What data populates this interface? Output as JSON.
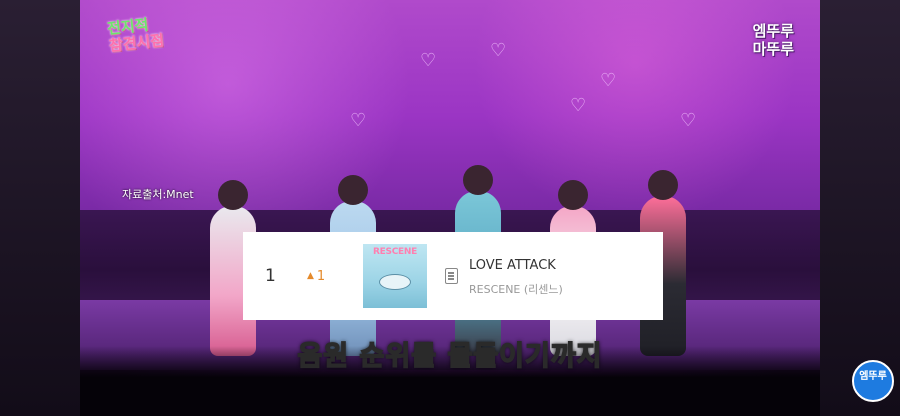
{
  "overlay": {
    "show_logo_line1": "전지적",
    "show_logo_line2": "참견시점",
    "brand_logo_line1": "엠뚜루",
    "brand_logo_line2": "마뚜루",
    "source": "자료출처:Mnet",
    "subtitle": "음원 순위를 물들이기까지",
    "corner_badge": "엠뚜루"
  },
  "chart_row": {
    "rank": "1",
    "rank_change": "1",
    "rank_change_direction": "up",
    "album_art_text": "RESCENE",
    "song_title": "LOVE ATTACK",
    "artist": "RESCENE (리센느)"
  },
  "colors": {
    "rank_up": "#e58a2b",
    "stage_pink": "#b04acb",
    "badge_blue": "#1e7be0"
  },
  "icons": [
    "lyrics-icon",
    "up-arrow-icon"
  ]
}
